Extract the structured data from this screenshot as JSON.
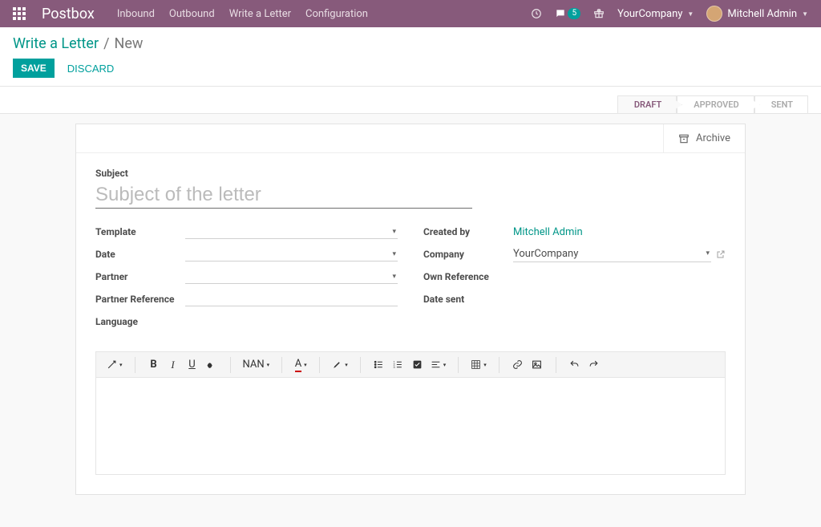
{
  "navbar": {
    "brand": "Postbox",
    "links": [
      "Inbound",
      "Outbound",
      "Write a Letter",
      "Configuration"
    ],
    "message_count": "5",
    "company": "YourCompany",
    "user": "Mitchell Admin"
  },
  "breadcrumb": {
    "root": "Write a Letter",
    "current": "New"
  },
  "actions": {
    "save": "SAVE",
    "discard": "DISCARD"
  },
  "statusbar": {
    "steps": [
      "DRAFT",
      "APPROVED",
      "SENT"
    ],
    "active": 0
  },
  "buttonbox": {
    "archive": "Archive"
  },
  "form": {
    "subject_label": "Subject",
    "subject_placeholder": "Subject of the letter",
    "left": {
      "template": "Template",
      "date": "Date",
      "partner": "Partner",
      "partner_ref": "Partner Reference",
      "language": "Language"
    },
    "right": {
      "created_by": "Created by",
      "created_by_val": "Mitchell Admin",
      "company": "Company",
      "company_val": "YourCompany",
      "own_ref": "Own Reference",
      "date_sent": "Date sent"
    }
  },
  "editor": {
    "font_label": "NAN",
    "font_letter": "A"
  }
}
